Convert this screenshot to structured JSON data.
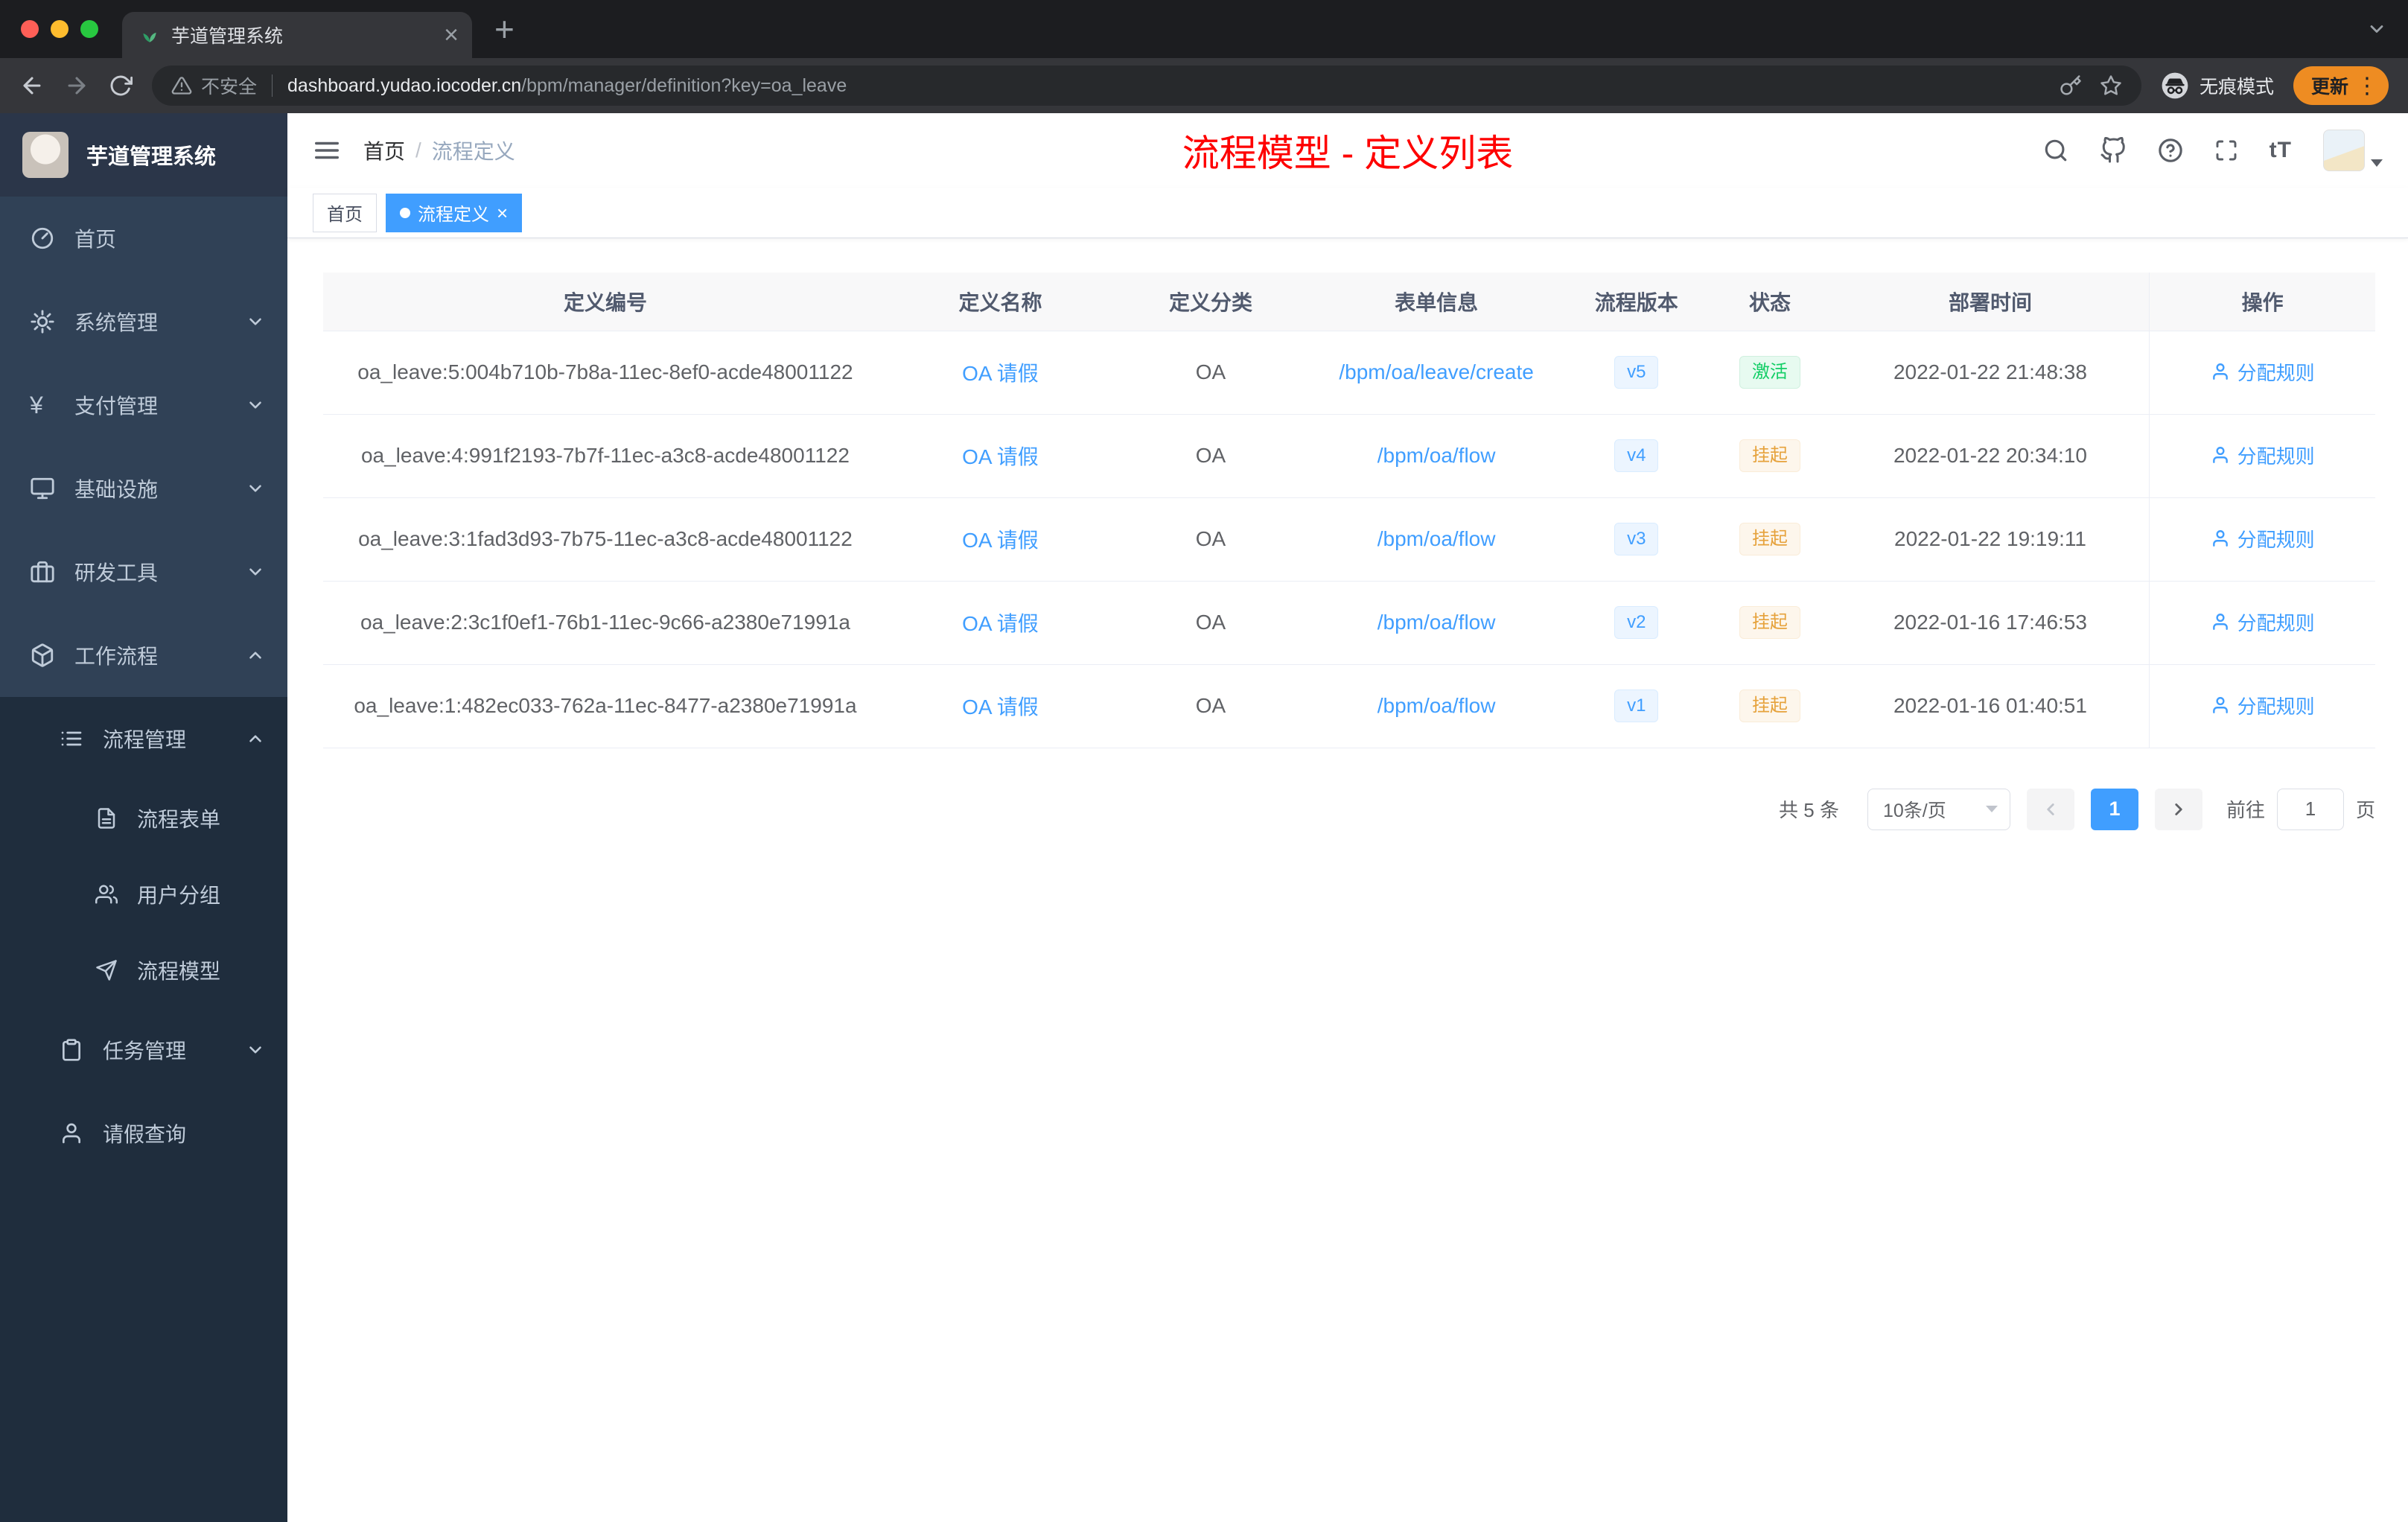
{
  "colors": {
    "accent": "#409eff",
    "success": "#13ce66",
    "warning": "#e6a23c",
    "annotation_red": "#fe0000",
    "update_pill": "#ee8c22",
    "sidebar_bg": "#304156",
    "submenu_bg": "#1f2d3d"
  },
  "browser": {
    "tab_title": "芋道管理系统",
    "security_label": "不安全",
    "url_domain": "dashboard.yudao.iocoder.cn",
    "url_path": "/bpm/manager/definition?key=oa_leave",
    "incognito_label": "无痕模式",
    "update_label": "更新"
  },
  "sidebar": {
    "app_title": "芋道管理系统",
    "top_items": [
      {
        "label": "首页",
        "icon": "dashboard-icon"
      },
      {
        "label": "系统管理",
        "icon": "gear-icon"
      },
      {
        "label": "支付管理",
        "icon": "yen-icon"
      },
      {
        "label": "基础设施",
        "icon": "monitor-icon"
      },
      {
        "label": "研发工具",
        "icon": "briefcase-icon"
      },
      {
        "label": "工作流程",
        "icon": "box-icon"
      }
    ],
    "sub_items": [
      {
        "label": "流程管理",
        "icon": "list-icon"
      },
      {
        "label": "流程表单",
        "icon": "file-text-icon"
      },
      {
        "label": "用户分组",
        "icon": "users-icon"
      },
      {
        "label": "流程模型",
        "icon": "paper-plane-icon"
      },
      {
        "label": "任务管理",
        "icon": "clipboard-icon"
      },
      {
        "label": "请假查询",
        "icon": "user-icon"
      }
    ]
  },
  "navbar": {
    "breadcrumb_home": "首页",
    "breadcrumb_separator": "/",
    "breadcrumb_current": "流程定义",
    "annotation": "流程模型 - 定义列表",
    "font_size_label": "tT"
  },
  "tags": {
    "home": "首页",
    "active": "流程定义"
  },
  "table": {
    "columns": [
      "定义编号",
      "定义名称",
      "定义分类",
      "表单信息",
      "流程版本",
      "状态",
      "部署时间",
      "操作"
    ],
    "rows": [
      {
        "id": "oa_leave:5:004b710b-7b8a-11ec-8ef0-acde48001122",
        "name": "OA 请假",
        "category": "OA",
        "form": "/bpm/oa/leave/create",
        "version": "v5",
        "status": "激活",
        "status_type": "success",
        "deploy_time": "2022-01-22 21:48:38",
        "action": "分配规则"
      },
      {
        "id": "oa_leave:4:991f2193-7b7f-11ec-a3c8-acde48001122",
        "name": "OA 请假",
        "category": "OA",
        "form": "/bpm/oa/flow",
        "version": "v4",
        "status": "挂起",
        "status_type": "warning",
        "deploy_time": "2022-01-22 20:34:10",
        "action": "分配规则"
      },
      {
        "id": "oa_leave:3:1fad3d93-7b75-11ec-a3c8-acde48001122",
        "name": "OA 请假",
        "category": "OA",
        "form": "/bpm/oa/flow",
        "version": "v3",
        "status": "挂起",
        "status_type": "warning",
        "deploy_time": "2022-01-22 19:19:11",
        "action": "分配规则"
      },
      {
        "id": "oa_leave:2:3c1f0ef1-76b1-11ec-9c66-a2380e71991a",
        "name": "OA 请假",
        "category": "OA",
        "form": "/bpm/oa/flow",
        "version": "v2",
        "status": "挂起",
        "status_type": "warning",
        "deploy_time": "2022-01-16 17:46:53",
        "action": "分配规则"
      },
      {
        "id": "oa_leave:1:482ec033-762a-11ec-8477-a2380e71991a",
        "name": "OA 请假",
        "category": "OA",
        "form": "/bpm/oa/flow",
        "version": "v1",
        "status": "挂起",
        "status_type": "warning",
        "deploy_time": "2022-01-16 01:40:51",
        "action": "分配规则"
      }
    ]
  },
  "pagination": {
    "total": "共 5 条",
    "page_size": "10条/页",
    "current_page": "1",
    "goto_label": "前往",
    "goto_value": "1",
    "page_unit": "页"
  }
}
